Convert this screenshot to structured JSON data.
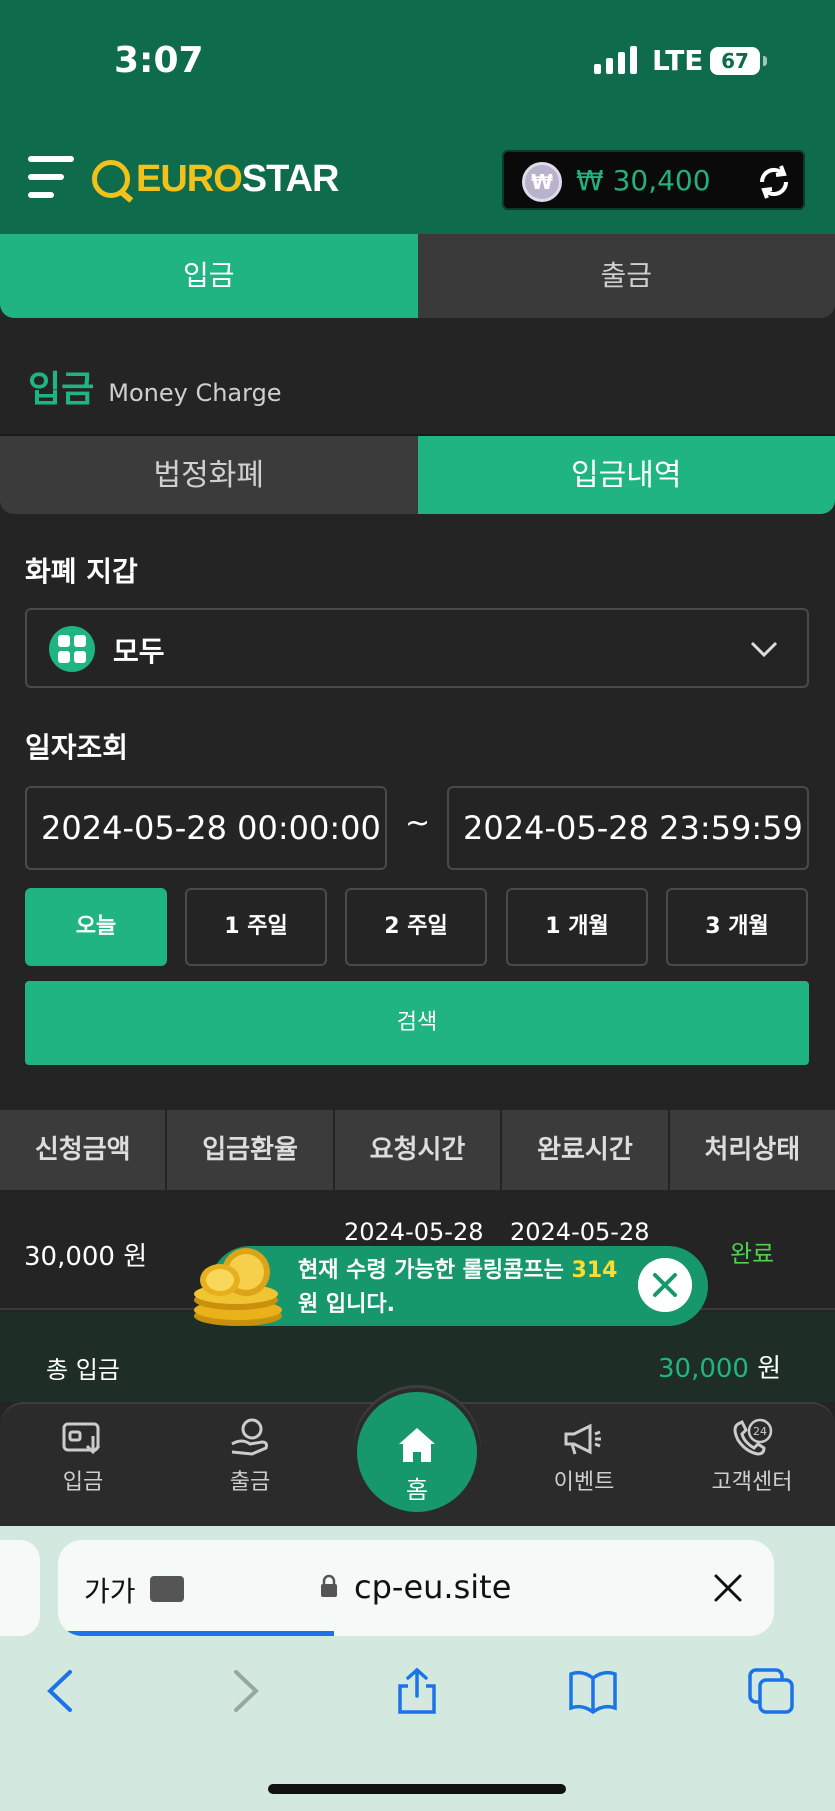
{
  "status_bar": {
    "time": "3:07",
    "network": "LTE",
    "battery": "67"
  },
  "header": {
    "logo_prefix": "EURO",
    "logo_suffix": "STAR",
    "currency_symbol": "₩",
    "balance": "₩ 30,400"
  },
  "top_tabs": [
    {
      "label": "입금",
      "active": true
    },
    {
      "label": "출금",
      "active": false
    }
  ],
  "section": {
    "title": "입금",
    "subtitle": "Money Charge"
  },
  "sub_tabs": [
    {
      "label": "법정화폐",
      "active": false
    },
    {
      "label": "입금내역",
      "active": true
    }
  ],
  "wallet": {
    "label": "화폐 지갑",
    "selected": "모두"
  },
  "date_query": {
    "label": "일자조회",
    "start": "2024-05-28 00:00:00",
    "separator": "~",
    "end": "2024-05-28 23:59:59"
  },
  "periods": [
    {
      "label": "오늘",
      "active": true
    },
    {
      "label": "1 주일",
      "active": false
    },
    {
      "label": "2 주일",
      "active": false
    },
    {
      "label": "1 개월",
      "active": false
    },
    {
      "label": "3 개월",
      "active": false
    }
  ],
  "search_label": "검색",
  "table": {
    "headers": [
      "신청금액",
      "입금환율",
      "요청시간",
      "완료시간",
      "처리상태"
    ],
    "rows": [
      {
        "amount": "30,000 원",
        "request_time": "2024-05-28",
        "complete_time": "2024-05-28",
        "status": "완료"
      }
    ]
  },
  "toast": {
    "line1": "현재 수령 가능한 롤링콤프는",
    "amount": "314",
    "line2": "원 입니다."
  },
  "total": {
    "label": "총 입금",
    "value": "30,000",
    "unit": "원"
  },
  "bottom_nav": {
    "items": [
      {
        "label": "입금",
        "icon": "deposit-wallet-icon"
      },
      {
        "label": "출금",
        "icon": "withdraw-hand-coin-icon"
      },
      {
        "label": "홈",
        "icon": "home-icon"
      },
      {
        "label": "이벤트",
        "icon": "megaphone-icon"
      },
      {
        "label": "고객센터",
        "icon": "support-24-phone-icon"
      }
    ]
  },
  "browser": {
    "text_size": "가가",
    "url": "cp-eu.site"
  },
  "colors": {
    "brand_green": "#1fb482",
    "header_green": "#0e6b4c",
    "logo_yellow": "#f2c21a",
    "status_done": "#4fd04f",
    "highlight_yellow": "#ffdc2e"
  }
}
